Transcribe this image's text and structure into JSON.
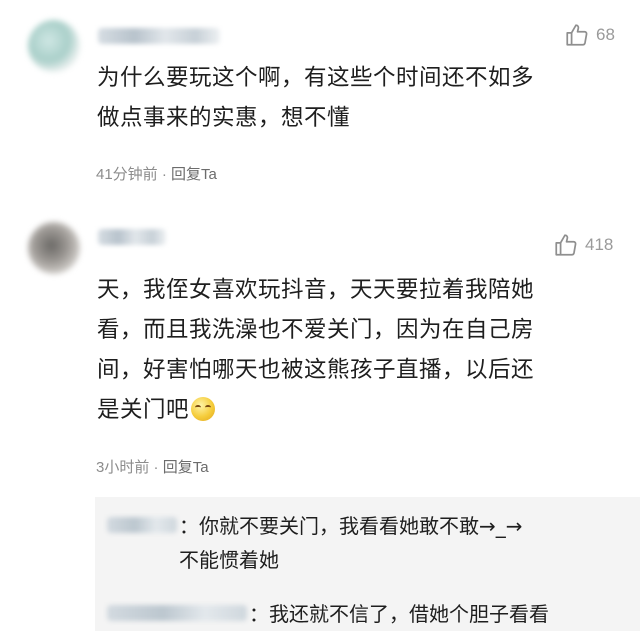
{
  "comments": [
    {
      "likes": "68",
      "text": "为什么要玩这个啊，有这些个时间还不如多\n做点事来的实惠，想不懂",
      "time": "41分钟前",
      "separator": "·",
      "reply_label": "回复Ta"
    },
    {
      "likes": "418",
      "text": "天，我侄女喜欢玩抖音，天天要拉着我陪她\n看，而且我洗澡也不爱关门，因为在自己房\n间，好害怕哪天也被这熊孩子直播，以后还\n是关门吧",
      "time": "3小时前",
      "separator": "·",
      "reply_label": "回复Ta"
    }
  ],
  "replies": [
    {
      "text": "：你就不要关门，我看看她敢不敢→_→\n不能惯着她"
    },
    {
      "text": "：我还就不信了，借她个胆子看看"
    }
  ],
  "icons": {
    "like": "thumbs-up-icon",
    "emoji": "laughing-emoji-icon"
  },
  "colors": {
    "meta": "#8c8c8c",
    "reply_bg": "#f4f4f4"
  }
}
